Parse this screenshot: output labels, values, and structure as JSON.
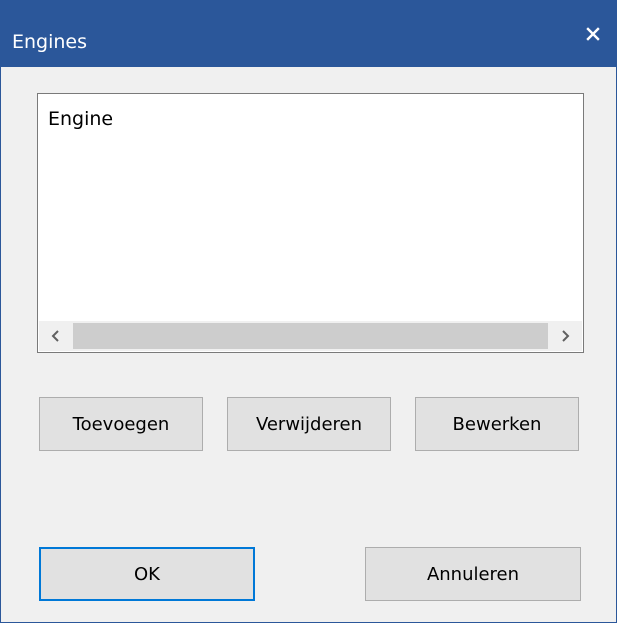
{
  "window": {
    "title": "Engines",
    "close_icon": "close-icon"
  },
  "engine_list": {
    "items": [
      "Engine"
    ],
    "scrollbar": {
      "left_arrow_icon": "chevron-left-icon",
      "right_arrow_icon": "chevron-right-icon"
    }
  },
  "actions": {
    "add_label": "Toevoegen",
    "remove_label": "Verwijderen",
    "edit_label": "Bewerken"
  },
  "footer": {
    "ok_label": "OK",
    "cancel_label": "Annuleren"
  },
  "colors": {
    "titlebar": "#2b579a",
    "focus_border": "#0078d7",
    "background": "#f0f0f0"
  }
}
